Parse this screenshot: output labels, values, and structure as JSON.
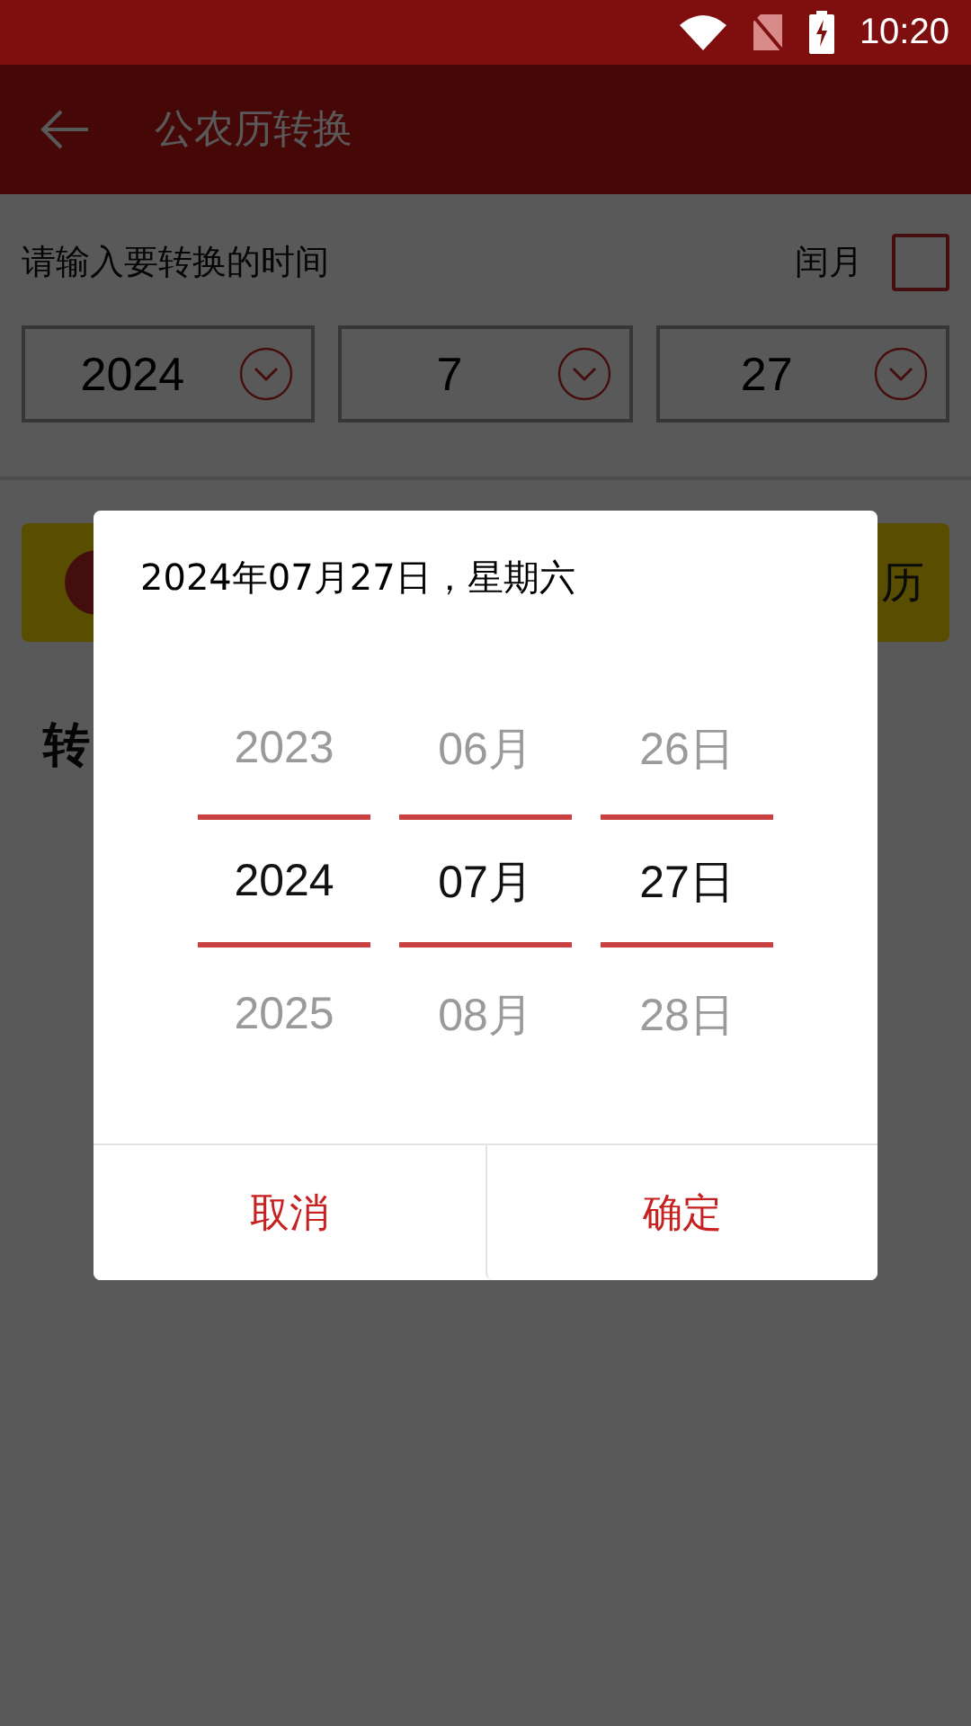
{
  "status_bar": {
    "time": "10:20"
  },
  "app_bar": {
    "title": "公农历转换"
  },
  "form": {
    "prompt": "请输入要转换的时间",
    "leap_month": {
      "label": "闰月",
      "checked": false
    },
    "selects": [
      {
        "value": "2024"
      },
      {
        "value": "7"
      },
      {
        "value": "27"
      }
    ]
  },
  "banner": {
    "text": "历"
  },
  "heading": {
    "text": "转"
  },
  "dialog": {
    "title": "2024年07月27日，星期六",
    "columns": [
      {
        "items": [
          {
            "label": "2023",
            "selected": false
          },
          {
            "label": "2024",
            "selected": true
          },
          {
            "label": "2025",
            "selected": false
          }
        ]
      },
      {
        "items": [
          {
            "label": "06月",
            "selected": false
          },
          {
            "label": "07月",
            "selected": true
          },
          {
            "label": "08月",
            "selected": false
          }
        ]
      },
      {
        "items": [
          {
            "label": "26日",
            "selected": false
          },
          {
            "label": "27日",
            "selected": true
          },
          {
            "label": "28日",
            "selected": false
          }
        ]
      }
    ],
    "buttons": [
      "取消",
      "确定"
    ]
  }
}
